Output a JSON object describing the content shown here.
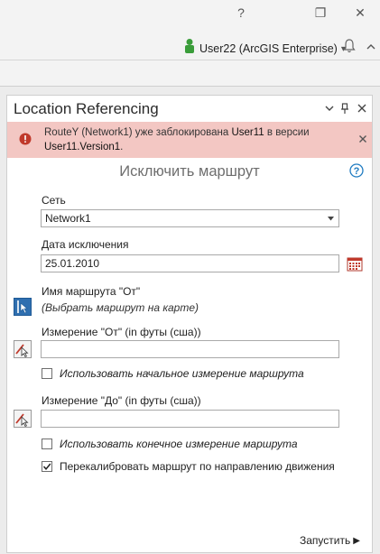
{
  "window": {
    "help_symbol": "?",
    "restore_symbol": "❐",
    "close_symbol": "✕"
  },
  "userbar": {
    "user_label": "User22 (ArcGIS Enterprise)",
    "dropdown_symbol": "▾",
    "collapse_symbol": "^"
  },
  "pane": {
    "title": "Location Referencing",
    "menu_symbol": "⌄",
    "pin_symbol": "⊥",
    "close_symbol": "✕"
  },
  "alert": {
    "part1": "RouteY (Network1) уже заблокирована ",
    "user": "User11",
    "part2": " в версии ",
    "version": "User11.Version1",
    "part3": ".",
    "dismiss_symbol": "✕"
  },
  "tool": {
    "title": "Исключить маршрут",
    "help_symbol": "?",
    "network_label": "Сеть",
    "network_value": "Network1",
    "date_label": "Дата исключения",
    "date_value": "25.01.2010",
    "route_from_label": "Имя маршрута \"От\"",
    "route_from_hint": "(Выбрать маршрут на карте)",
    "measure_from_label": "Измерение \"От\" (in футы (сша))",
    "measure_from_value": "",
    "use_start_label": "Использовать начальное измерение маршрута",
    "use_start_checked": false,
    "measure_to_label": "Измерение \"До\" (in футы (сша))",
    "measure_to_value": "",
    "use_end_label": "Использовать конечное измерение маршрута",
    "use_end_checked": false,
    "recalibrate_label": "Перекалибровать маршрут по направлению движения",
    "recalibrate_checked": true,
    "run_label": "Запустить",
    "run_symbol": "▶"
  },
  "colors": {
    "alert_bg": "#f3c7c3",
    "alert_icon": "#c0392b",
    "accent": "#1f7bc1",
    "user_icon": "#3a9d3a"
  }
}
